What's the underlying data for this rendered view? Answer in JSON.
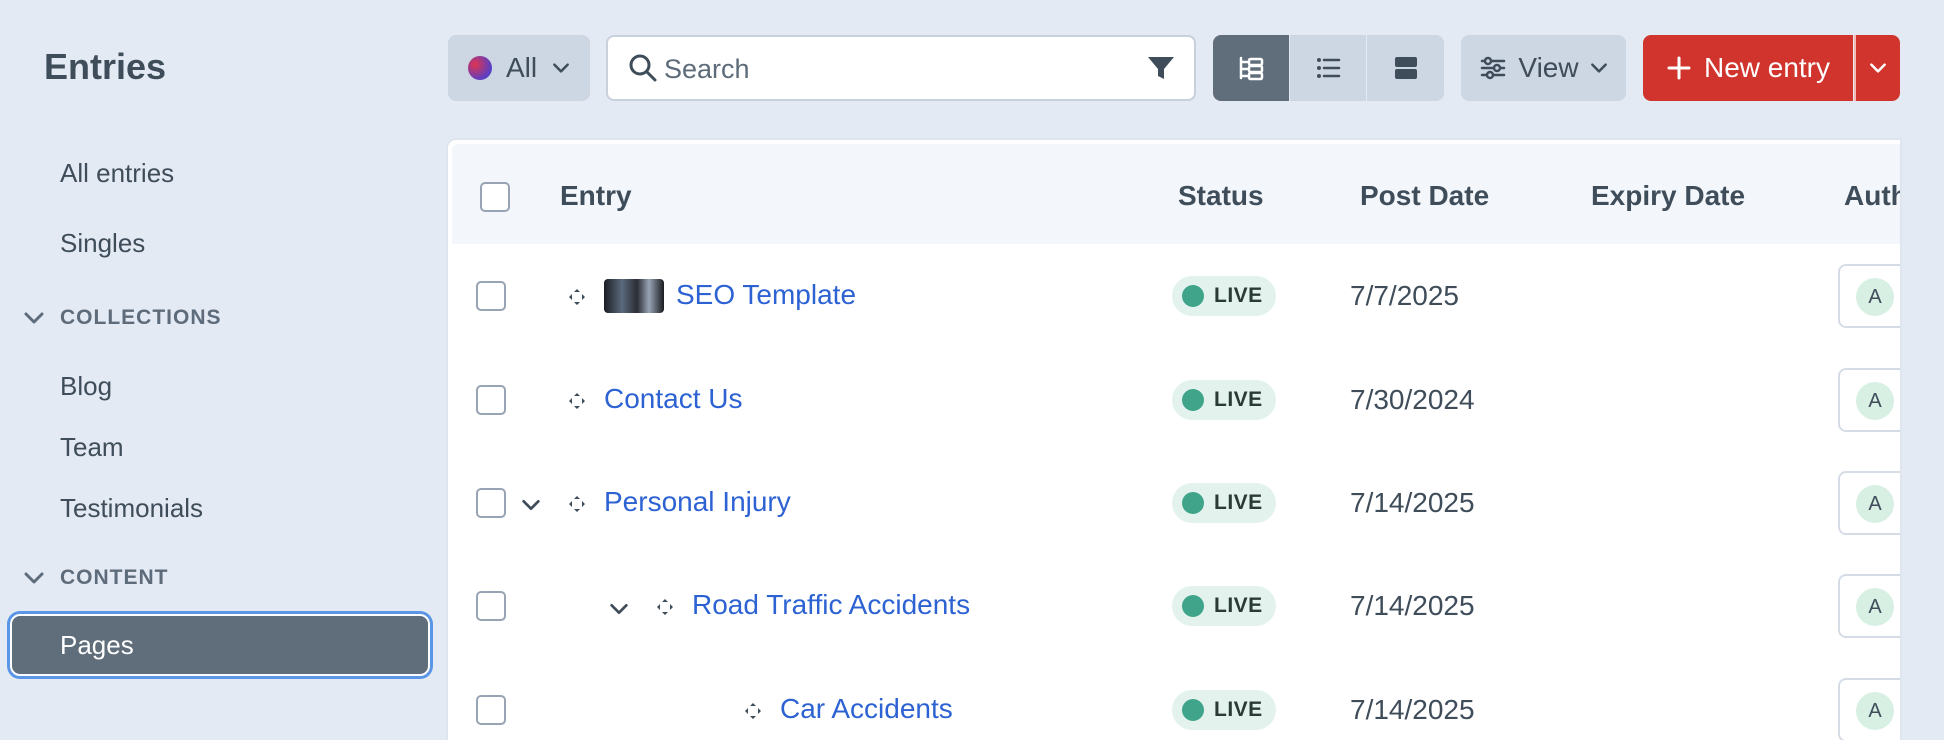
{
  "sidebar": {
    "title": "Entries",
    "items": [
      "All entries",
      "Singles"
    ],
    "collections_heading": "COLLECTIONS",
    "collections": [
      "Blog",
      "Team",
      "Testimonials"
    ],
    "content_heading": "CONTENT",
    "content_selected": "Pages"
  },
  "toolbar": {
    "site_label": "All",
    "search_placeholder": "Search",
    "view_label": "View",
    "new_entry_label": "New entry"
  },
  "table": {
    "headers": {
      "entry": "Entry",
      "status": "Status",
      "post_date": "Post Date",
      "expiry_date": "Expiry Date",
      "author": "Auth"
    },
    "rows": [
      {
        "title": "SEO Template",
        "status": "LIVE",
        "post_date": "7/7/2025",
        "author_initial": "A"
      },
      {
        "title": "Contact Us",
        "status": "LIVE",
        "post_date": "7/30/2024",
        "author_initial": "A"
      },
      {
        "title": "Personal Injury",
        "status": "LIVE",
        "post_date": "7/14/2025",
        "author_initial": "A"
      },
      {
        "title": "Road Traffic Accidents",
        "status": "LIVE",
        "post_date": "7/14/2025",
        "author_initial": "A"
      },
      {
        "title": "Car Accidents",
        "status": "LIVE",
        "post_date": "7/14/2025",
        "author_initial": "A"
      }
    ]
  },
  "colors": {
    "accent_red": "#d0342c",
    "link_blue": "#2d62d3",
    "live_green": "#3fa48a",
    "sidebar_selected": "#606d7b"
  }
}
